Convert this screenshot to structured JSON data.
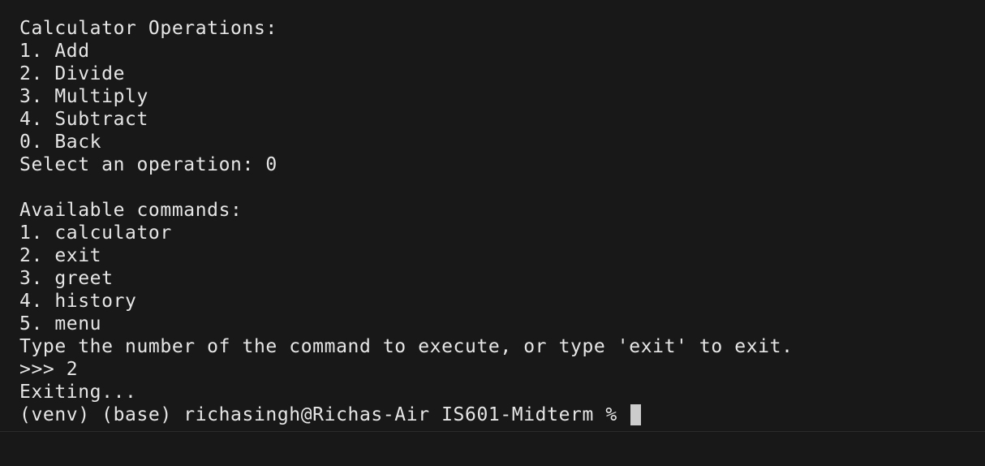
{
  "terminal": {
    "lines": [
      "Calculator Operations:",
      "1. Add",
      "2. Divide",
      "3. Multiply",
      "4. Subtract",
      "0. Back",
      "Select an operation: 0",
      "",
      "Available commands:",
      "1. calculator",
      "2. exit",
      "3. greet",
      "4. history",
      "5. menu",
      "Type the number of the command to execute, or type 'exit' to exit.",
      ">>> 2",
      "Exiting..."
    ],
    "prompt": "(venv) (base) richasingh@Richas-Air IS601-Midterm % "
  }
}
